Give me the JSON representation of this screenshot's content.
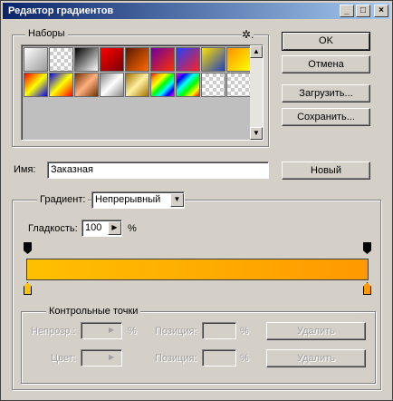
{
  "window": {
    "title": "Редактор градиентов",
    "controls": {
      "minimize": "_",
      "maximize": "□",
      "close": "×"
    }
  },
  "presets": {
    "label": "Наборы",
    "menu_icon": "gear-icon",
    "menu_glyph": "✲."
  },
  "buttons": {
    "ok": "OK",
    "cancel": "Отмена",
    "load": "Загрузить...",
    "save": "Сохранить...",
    "new": "Новый",
    "delete_opacity": "Удалить",
    "delete_color": "Удалить"
  },
  "name": {
    "label": "Имя:",
    "value": "Заказная"
  },
  "gradient": {
    "type_label": "Градиент:",
    "type_value": "Непрерывный",
    "smoothness_label": "Гладкость:",
    "smoothness_value": "100",
    "smoothness_unit": "%",
    "colors": {
      "start": "#ffc000",
      "end": "#ff9900"
    }
  },
  "stops": {
    "label": "Контрольные точки",
    "opacity_label": "Непрозр.:",
    "opacity_unit": "%",
    "position_label_1": "Позиция:",
    "position_unit_1": "%",
    "color_label": "Цвет:",
    "position_label_2": "Позиция:",
    "position_unit_2": "%"
  }
}
